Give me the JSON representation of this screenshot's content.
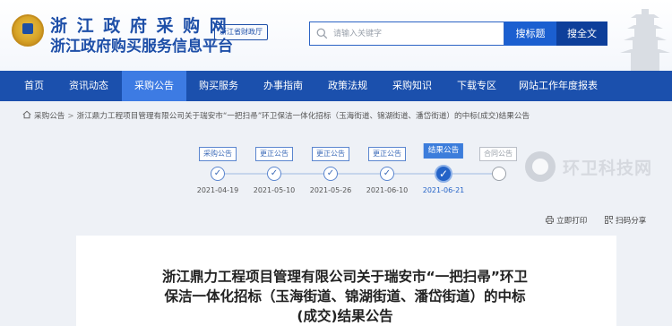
{
  "header": {
    "title": "浙 江 政 府 采 购 网",
    "subtitle": "浙江政府购买服务信息平台",
    "dept_badge": "浙江省财政厅",
    "search_placeholder": "请输入关键字",
    "search_title_button": "搜标题",
    "search_all_button": "搜全文"
  },
  "nav": {
    "items": [
      "首页",
      "资讯动态",
      "采购公告",
      "购买服务",
      "办事指南",
      "政策法规",
      "采购知识",
      "下载专区",
      "网站工作年度报表"
    ],
    "active_index": 2
  },
  "breadcrumb": {
    "items": [
      "采购公告",
      "浙江鼎力工程项目管理有限公司关于瑞安市“一把扫帚”环卫保洁一体化招标（玉海街道、锦湖街道、潘岱街道）的中标(成交)结果公告"
    ],
    "separator": ">"
  },
  "timeline": {
    "steps": [
      {
        "label": "采购公告",
        "date": "2021-04-19",
        "state": "done"
      },
      {
        "label": "更正公告",
        "date": "2021-05-10",
        "state": "done"
      },
      {
        "label": "更正公告",
        "date": "2021-05-26",
        "state": "done"
      },
      {
        "label": "更正公告",
        "date": "2021-06-10",
        "state": "done"
      },
      {
        "label": "结果公告",
        "date": "2021-06-21",
        "state": "current"
      },
      {
        "label": "合同公告",
        "date": "",
        "state": "pending"
      }
    ]
  },
  "tools": {
    "print": "立即打印",
    "share": "扫码分享"
  },
  "article": {
    "title": "浙江鼎力工程项目管理有限公司关于瑞安市“一把扫帚”环卫保洁一体化招标（玉海街道、锦湖街道、潘岱街道）的中标(成交)结果公告"
  },
  "watermark": {
    "text": "环卫科技网"
  },
  "colors": {
    "brand_blue": "#1b50ad",
    "nav_active": "#3d7be3",
    "timeline_current": "#2463c7"
  }
}
